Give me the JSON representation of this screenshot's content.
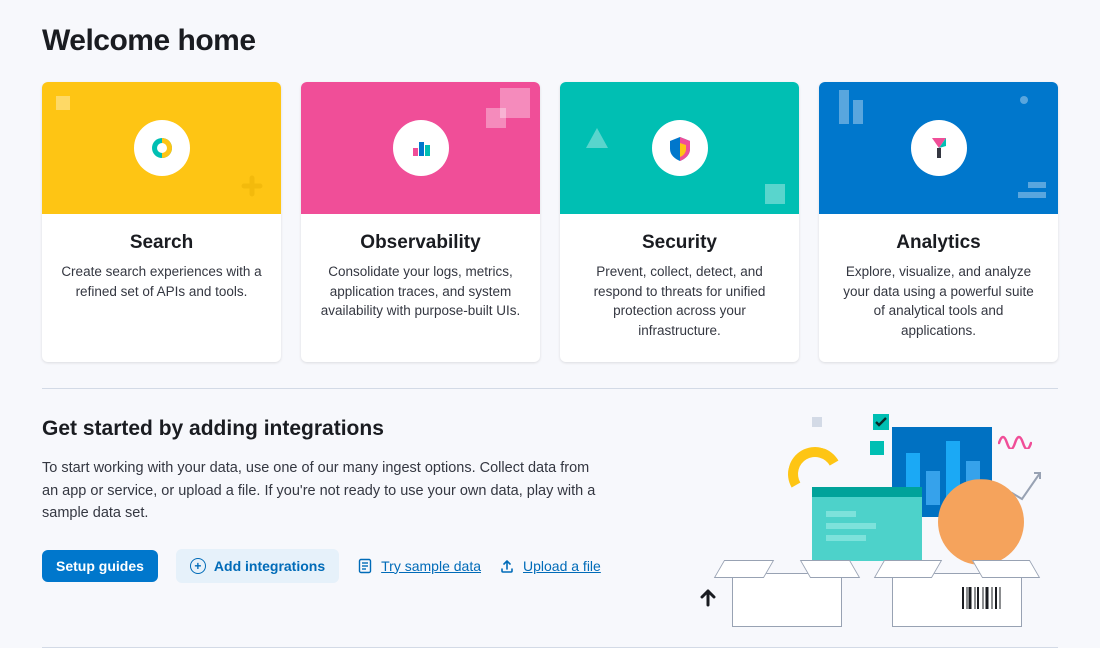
{
  "title": "Welcome home",
  "cards": [
    {
      "title": "Search",
      "desc": "Create search experiences with a refined set of APIs and tools."
    },
    {
      "title": "Observability",
      "desc": "Consolidate your logs, metrics, application traces, and system availability with purpose-built UIs."
    },
    {
      "title": "Security",
      "desc": "Prevent, collect, detect, and respond to threats for unified protection across your infrastructure."
    },
    {
      "title": "Analytics",
      "desc": "Explore, visualize, and analyze your data using a powerful suite of analytical tools and applications."
    }
  ],
  "getStarted": {
    "title": "Get started by adding integrations",
    "desc": "To start working with your data, use one of our many ingest options. Collect data from an app or service, or upload a file. If you're not ready to use your own data, play with a sample data set.",
    "setupGuides": "Setup guides",
    "addIntegrations": "Add integrations",
    "trySample": "Try sample data",
    "uploadFile": "Upload a file"
  }
}
